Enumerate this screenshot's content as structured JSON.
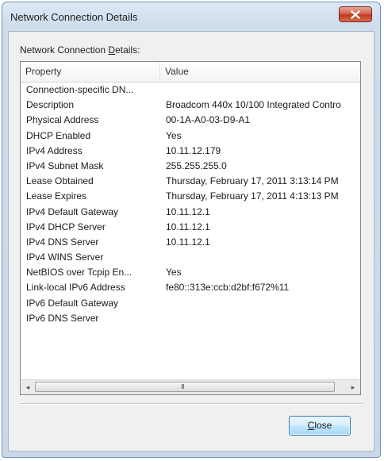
{
  "window": {
    "title": "Network Connection Details"
  },
  "dialog": {
    "caption_prefix": "Network Connection ",
    "caption_accel": "D",
    "caption_suffix": "etails:"
  },
  "listview": {
    "headers": {
      "property": "Property",
      "value": "Value"
    },
    "rows": [
      {
        "property": "Connection-specific DN...",
        "value": ""
      },
      {
        "property": "Description",
        "value": "Broadcom 440x 10/100 Integrated Contro"
      },
      {
        "property": "Physical Address",
        "value": "00-1A-A0-03-D9-A1"
      },
      {
        "property": "DHCP Enabled",
        "value": "Yes"
      },
      {
        "property": "IPv4 Address",
        "value": "10.11.12.179"
      },
      {
        "property": "IPv4 Subnet Mask",
        "value": "255.255.255.0"
      },
      {
        "property": "Lease Obtained",
        "value": "Thursday, February 17, 2011 3:13:14 PM"
      },
      {
        "property": "Lease Expires",
        "value": "Thursday, February 17, 2011 4:13:13 PM"
      },
      {
        "property": "IPv4 Default Gateway",
        "value": "10.11.12.1"
      },
      {
        "property": "IPv4 DHCP Server",
        "value": "10.11.12.1"
      },
      {
        "property": "IPv4 DNS Server",
        "value": "10.11.12.1"
      },
      {
        "property": "IPv4 WINS Server",
        "value": ""
      },
      {
        "property": "NetBIOS over Tcpip En...",
        "value": "Yes"
      },
      {
        "property": "Link-local IPv6 Address",
        "value": "fe80::313e:ccb:d2bf:f672%11"
      },
      {
        "property": "IPv6 Default Gateway",
        "value": ""
      },
      {
        "property": "IPv6 DNS Server",
        "value": ""
      }
    ],
    "scrollbar": {
      "left_arrow": "◂",
      "right_arrow": "▸",
      "grip": "III"
    }
  },
  "buttons": {
    "close_accel": "C",
    "close_rest": "lose"
  },
  "colors": {
    "title_close_red": "#c0391c",
    "button_border_blue": "#3c7fb1"
  }
}
